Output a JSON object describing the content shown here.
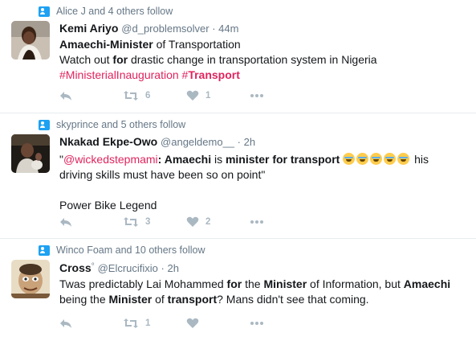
{
  "tweets": [
    {
      "context": "Alice J and 4 others follow",
      "name": "Kemi Ariyo",
      "handle": "@d_problemsolver",
      "dot": " · ",
      "time": "44m",
      "line1_bold1": "Amaechi",
      "line1_dash": "-",
      "line1_bold2": "Minister",
      "line1_rest": " of Transportation",
      "line2_a": "Watch out ",
      "line2_bold": "for",
      "line2_b": " drastic change in transportation system in Nigeria",
      "tag1": "#MinisterialInauguration",
      "tag2_hash": "#",
      "tag2_bold": "Transport",
      "retweets": "6",
      "likes": "1"
    },
    {
      "context": "skyprince and 5 others follow",
      "name": "Nkakad Ekpe-Owo",
      "handle": "@angeldemo__",
      "dot": " · ",
      "time": "2h",
      "quote_open": "\"",
      "mention": "@wickedstepmami",
      "colon": ": ",
      "b1": "Amaechi",
      "t1": " is ",
      "b2": "minister",
      "t2": " ",
      "b3": "for",
      "t3": " ",
      "b4": "transport",
      "t4": " his",
      "line2": "driving skills must have been so on point\"",
      "line3": "Power Bike Legend",
      "retweets": "3",
      "likes": "2"
    },
    {
      "context": "Winco Foam and 10 others follow",
      "name": "Cross",
      "name_mark": "°",
      "handle": "@Elcrucifixio",
      "dot": " · ",
      "time": "2h",
      "a1": "Twas predictably Lai Mohammed ",
      "b1": "for",
      "a2": " the ",
      "b2": "Minister",
      "a3": " of Information, but ",
      "b3": "Amaechi",
      "line2_a": "being the ",
      "line2_b1": "Minister",
      "line2_a2": " of ",
      "line2_b2": "transport",
      "line2_a3": "? Mans didn't see that coming.",
      "retweets": "1",
      "likes": ""
    }
  ],
  "icons": {
    "context": "person-follow-icon",
    "reply": "reply-icon",
    "retweet": "retweet-icon",
    "like": "heart-icon",
    "more": "more-dots-icon"
  },
  "colors": {
    "accent": "#1da1f2",
    "hashtag": "#e0245e",
    "muted": "#657786",
    "action": "#aab8c2"
  }
}
